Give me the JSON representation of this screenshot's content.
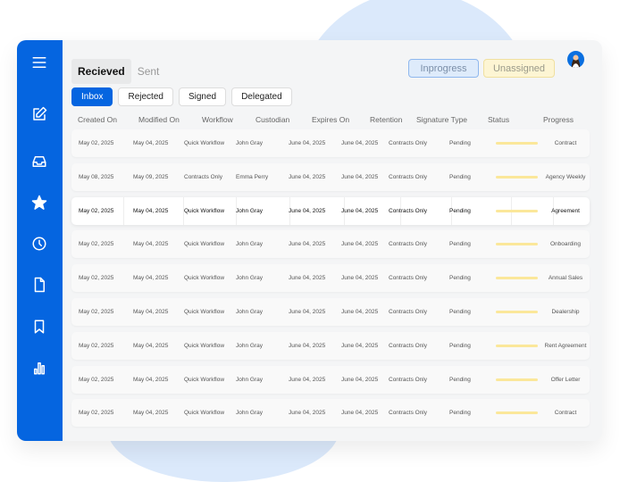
{
  "tabs": [
    "Recieved",
    "Sent"
  ],
  "filters": [
    "Inbox",
    "Rejected",
    "Signed",
    "Delegated"
  ],
  "badges": {
    "inprogress": "Inprogress",
    "unassigned": "Unassigned"
  },
  "columns": [
    "Created On",
    "Modified On",
    "Workflow",
    "Custodian",
    "Expires On",
    "Retention",
    "Signature Type",
    "Status",
    "Progress"
  ],
  "sidebar_icons": [
    "menu-icon",
    "edit-icon",
    "inbox-icon",
    "star-icon",
    "clock-icon",
    "file-icon",
    "bookmark-icon",
    "chart-icon"
  ],
  "colors": {
    "accent": "#0565e0",
    "progress": "#fbe79a"
  },
  "rows": [
    {
      "created": "May 02, 2025",
      "modified": "May 04, 2025",
      "workflow": "Quick Workflow",
      "custodian": "John Gray",
      "date1": "June 04, 2025",
      "date2": "June 04, 2025",
      "retention": "Contracts Only",
      "status": "Pending",
      "name": "Contract"
    },
    {
      "created": "May 08, 2025",
      "modified": "May 09, 2025",
      "workflow": "Contracts Only",
      "custodian": "Emma Perry",
      "date1": "June 04, 2025",
      "date2": "June 04, 2025",
      "retention": "Contracts Only",
      "status": "Pending",
      "name": "Agency Weekly"
    },
    {
      "created": "May 02, 2025",
      "modified": "May 04, 2025",
      "workflow": "Quick Workflow",
      "custodian": "John Gray",
      "date1": "June 04, 2025",
      "date2": "June 04, 2025",
      "retention": "Contracts Only",
      "status": "Pending",
      "name": "Agreement",
      "highlighted": true
    },
    {
      "created": "May 02, 2025",
      "modified": "May 04, 2025",
      "workflow": "Quick Workflow",
      "custodian": "John Gray",
      "date1": "June 04, 2025",
      "date2": "June 04, 2025",
      "retention": "Contracts Only",
      "status": "Pending",
      "name": "Onboarding"
    },
    {
      "created": "May 02, 2025",
      "modified": "May 04, 2025",
      "workflow": "Quick Workflow",
      "custodian": "John Gray",
      "date1": "June 04, 2025",
      "date2": "June 04, 2025",
      "retention": "Contracts Only",
      "status": "Pending",
      "name": "Annual Sales"
    },
    {
      "created": "May 02, 2025",
      "modified": "May 04, 2025",
      "workflow": "Quick Workflow",
      "custodian": "John Gray",
      "date1": "June 04, 2025",
      "date2": "June 04, 2025",
      "retention": "Contracts Only",
      "status": "Pending",
      "name": "Dealership"
    },
    {
      "created": "May 02, 2025",
      "modified": "May 04, 2025",
      "workflow": "Quick Workflow",
      "custodian": "John Gray",
      "date1": "June 04, 2025",
      "date2": "June 04, 2025",
      "retention": "Contracts Only",
      "status": "Pending",
      "name": "Rent Agreement"
    },
    {
      "created": "May 02, 2025",
      "modified": "May 04, 2025",
      "workflow": "Quick Workflow",
      "custodian": "John Gray",
      "date1": "June 04, 2025",
      "date2": "June 04, 2025",
      "retention": "Contracts Only",
      "status": "Pending",
      "name": "Offer Letter"
    },
    {
      "created": "May 02, 2025",
      "modified": "May 04, 2025",
      "workflow": "Quick Workflow",
      "custodian": "John Gray",
      "date1": "June 04, 2025",
      "date2": "June 04, 2025",
      "retention": "Contracts Only",
      "status": "Pending",
      "name": "Contract"
    }
  ]
}
